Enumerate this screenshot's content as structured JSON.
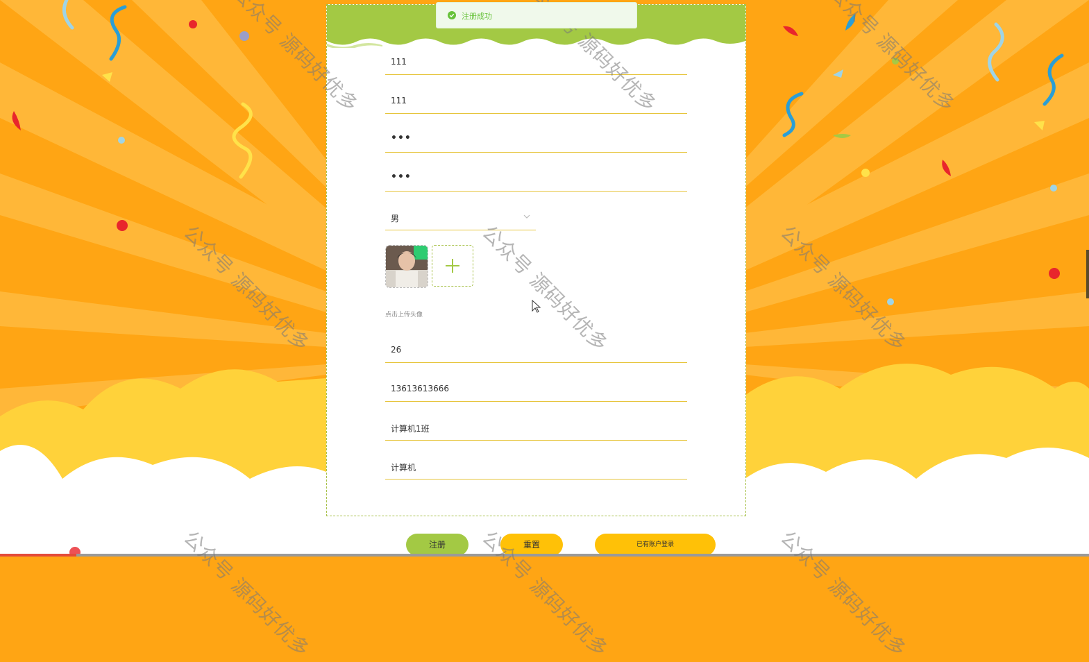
{
  "toast": {
    "message": "注册成功",
    "type": "success",
    "icon": "check-circle-icon",
    "color": "#67c23a"
  },
  "form": {
    "username": "111",
    "name": "111",
    "password": "•••",
    "confirm_password": "•••",
    "gender": "男",
    "avatar_hint": "点击上传头像",
    "avatar_upload_icon": "plus-icon",
    "age": "26",
    "phone": "13613613666",
    "class_name": "计算机1班",
    "major": "计算机"
  },
  "buttons": {
    "register": "注册",
    "reset": "重置",
    "login": "已有账户登录"
  },
  "watermark": "公众号 源码好优多",
  "colors": {
    "accent_green": "#a3c944",
    "accent_yellow": "#ffc107",
    "background_orange": "#ffa514",
    "underline": "#e6c43a"
  }
}
